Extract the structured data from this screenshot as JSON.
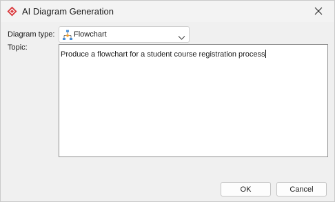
{
  "window": {
    "title": "AI Diagram Generation",
    "app_icon": "visual-paradigm-logo",
    "close_icon": "close-icon"
  },
  "form": {
    "diagram_type_label": "Diagram type:",
    "diagram_type_value": "Flowchart",
    "diagram_type_icon": "flowchart-icon",
    "topic_label": "Topic:",
    "topic_value": "Produce a flowchart for a student course registration process"
  },
  "buttons": {
    "ok_label": "OK",
    "cancel_label": "Cancel"
  },
  "colors": {
    "app_icon_red": "#d93a3e",
    "flowchart_icon_blue": "#4a90d9",
    "window_bg": "#f0f0f0"
  }
}
